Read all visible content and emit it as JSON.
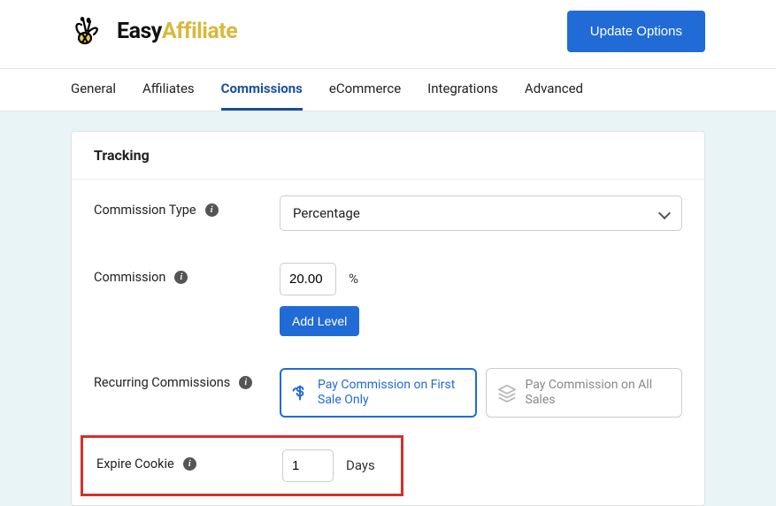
{
  "header": {
    "logo_easy": "Easy",
    "logo_affiliate": "Affiliate",
    "update_button": "Update Options"
  },
  "tabs": {
    "general": "General",
    "affiliates": "Affiliates",
    "commissions": "Commissions",
    "ecommerce": "eCommerce",
    "integrations": "Integrations",
    "advanced": "Advanced"
  },
  "card": {
    "title": "Tracking",
    "commission_type": {
      "label": "Commission Type",
      "value": "Percentage"
    },
    "commission": {
      "label": "Commission",
      "value": "20.00",
      "unit": "%",
      "add_level": "Add Level"
    },
    "recurring": {
      "label": "Recurring Commissions",
      "option_first": "Pay Commission on First Sale Only",
      "option_all": "Pay Commission on All Sales"
    },
    "expire_cookie": {
      "label": "Expire Cookie",
      "value": "1",
      "unit": "Days"
    }
  }
}
